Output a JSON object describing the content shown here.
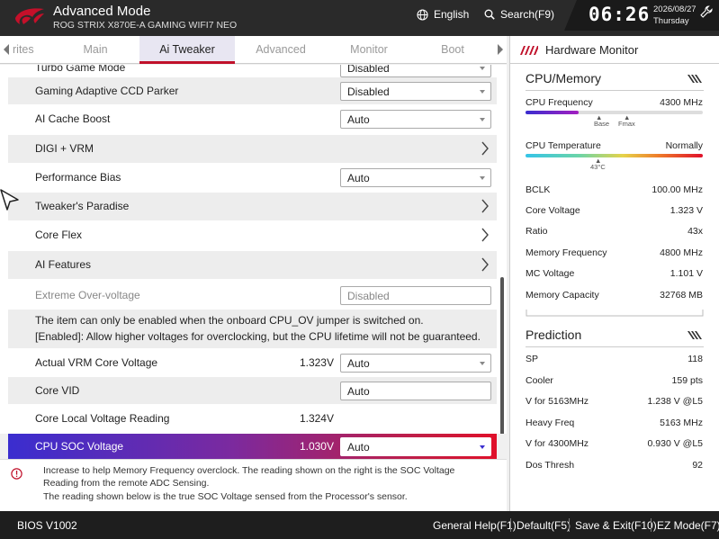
{
  "header": {
    "title": "Advanced Mode",
    "subtitle": "ROG STRIX X870E-A GAMING WIFI7 NEO",
    "language": "English",
    "search": "Search(F9)",
    "time": "06:26",
    "date": "2026/08/27",
    "day": "Thursday"
  },
  "tabs": [
    {
      "label": "rites"
    },
    {
      "label": "Main"
    },
    {
      "label": "Ai Tweaker"
    },
    {
      "label": "Advanced"
    },
    {
      "label": "Monitor"
    },
    {
      "label": "Boot"
    }
  ],
  "settings": {
    "turbo_game_mode": {
      "label": "Turbo Game Mode",
      "value": "Disabled"
    },
    "gaming_ccd_parker": {
      "label": "Gaming Adaptive CCD Parker",
      "value": "Disabled"
    },
    "ai_cache_boost": {
      "label": "AI Cache Boost",
      "value": "Auto"
    },
    "digi_vrm": {
      "label": "DIGI + VRM"
    },
    "performance_bias": {
      "label": "Performance Bias",
      "value": "Auto"
    },
    "tweakers_paradise": {
      "label": "Tweaker's Paradise"
    },
    "core_flex": {
      "label": "Core Flex"
    },
    "ai_features": {
      "label": "AI Features"
    },
    "extreme_overvoltage": {
      "label": "Extreme Over-voltage",
      "value": "Disabled"
    },
    "info_line1": "The item can only be enabled when the onboard CPU_OV jumper is switched on.",
    "info_line2": "[Enabled]: Allow higher voltages for overclocking, but the CPU lifetime will not be guaranteed.",
    "actual_vrm_core_voltage": {
      "label": "Actual VRM Core Voltage",
      "reading": "1.323V",
      "value": "Auto"
    },
    "core_vid": {
      "label": "Core VID",
      "value": "Auto"
    },
    "core_local_voltage": {
      "label": "Core Local Voltage Reading",
      "reading": "1.324V"
    },
    "cpu_soc_voltage": {
      "label": "CPU SOC Voltage",
      "reading": "1.030V",
      "value": "Auto"
    }
  },
  "help": {
    "line1": "Increase to help Memory Frequency overclock. The reading shown on the right is the SOC Voltage",
    "line2": "Reading from the remote ADC Sensing.",
    "line3": "The reading shown below is the true SOC Voltage sensed from the Processor's sensor."
  },
  "hw_monitor": {
    "title": "Hardware Monitor",
    "cpu_mem_title": "CPU/Memory",
    "cpu_freq_label": "CPU Frequency",
    "cpu_freq_value": "4300 MHz",
    "cpu_freq_fill": 0.3,
    "base_label": "Base",
    "fmax_label": "Fmax",
    "cpu_temp_label": "CPU Temperature",
    "cpu_temp_status": "Normally",
    "cpu_temp_marker": "43°C",
    "rows": [
      {
        "k": "BCLK",
        "v": "100.00 MHz"
      },
      {
        "k": "Core Voltage",
        "v": "1.323 V"
      },
      {
        "k": "Ratio",
        "v": "43x"
      },
      {
        "k": "Memory Frequency",
        "v": "4800 MHz"
      },
      {
        "k": "MC Voltage",
        "v": "1.101 V"
      },
      {
        "k": "Memory Capacity",
        "v": "32768 MB"
      }
    ],
    "prediction_title": "Prediction",
    "prediction": [
      {
        "k": "SP",
        "v": "118"
      },
      {
        "k": "Cooler",
        "v": "159 pts"
      },
      {
        "k": "V for 5163MHz",
        "v": "1.238 V @L5"
      },
      {
        "k": "Heavy Freq",
        "v": "5163 MHz"
      },
      {
        "k": "V for 4300MHz",
        "v": "0.930 V @L5"
      },
      {
        "k": "Dos Thresh",
        "v": "92"
      }
    ]
  },
  "footer": {
    "version": "BIOS V1002",
    "general_help": "General Help(F1)",
    "default": "Default(F5)",
    "save_exit": "Save & Exit(F10)",
    "ez_mode": "EZ Mode(F7)"
  },
  "colors": {
    "accent_red": "#c0102a",
    "selected_gradient_start": "#3a2dcf",
    "selected_gradient_end": "#e0102a",
    "header_bg": "#2a2a2a",
    "footer_bg": "#1e1e1e"
  }
}
